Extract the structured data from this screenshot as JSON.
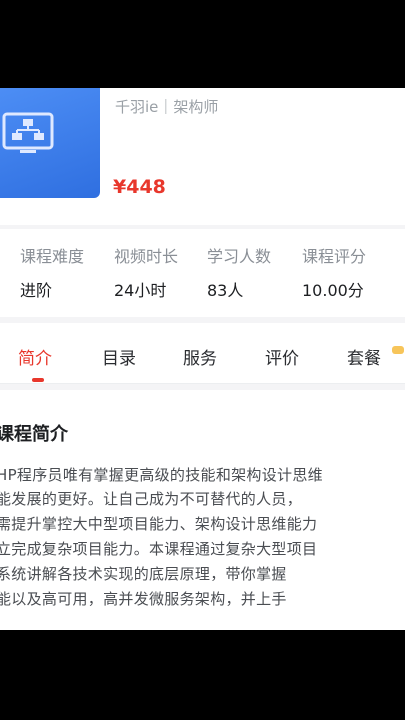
{
  "course": {
    "teacher": "千羽ie｜架构师",
    "price": "¥448"
  },
  "stats": [
    {
      "label": "课程难度",
      "value": "进阶"
    },
    {
      "label": "视频时长",
      "value": "24小时"
    },
    {
      "label": "学习人数",
      "value": "83人"
    },
    {
      "label": "课程评分",
      "value": "10.00分"
    }
  ],
  "tabs": [
    {
      "label": "简介",
      "active": true
    },
    {
      "label": "目录"
    },
    {
      "label": "服务"
    },
    {
      "label": "评价"
    },
    {
      "label": "套餐"
    }
  ],
  "intro": {
    "title": "课程简介",
    "lines": [
      "HP程序员唯有掌握更高级的技能和架构设计思维",
      "能发展的更好。让自己成为不可替代的人员，",
      "需提升掌控大中型项目能力、架构设计思维能力",
      "立完成复杂项目能力。本课程通过复杂大型项目",
      "系统讲解各技术实现的底层原理，带你掌握",
      "能以及高可用，高并发微服务架构，并上手"
    ]
  },
  "colors": {
    "accent": "#e8372c",
    "thumb": "#3b7cf0"
  }
}
